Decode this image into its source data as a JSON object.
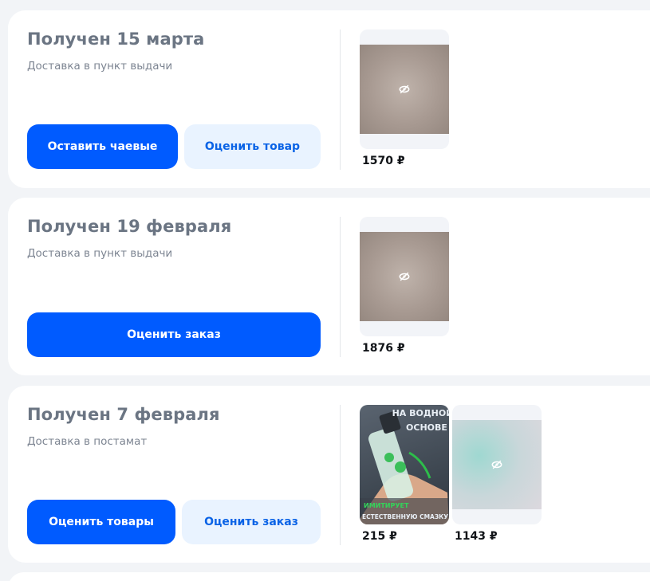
{
  "orders": [
    {
      "title": "Получен 15 марта",
      "subtitle": "Доставка в пункт выдачи",
      "buttons": [
        "Оставить чаевые",
        "Оценить товар"
      ],
      "products": [
        {
          "price": "1570 ₽",
          "image": "hidden-blurred"
        }
      ]
    },
    {
      "title": "Получен 19 февраля",
      "subtitle": "Доставка в пункт выдачи",
      "buttons": [
        "Оценить заказ"
      ],
      "products": [
        {
          "price": "1876 ₽",
          "image": "hidden-blurred"
        }
      ]
    },
    {
      "title": "Получен 7 февраля",
      "subtitle": "Доставка в постамат",
      "buttons": [
        "Оценить товары",
        "Оценить заказ"
      ],
      "products": [
        {
          "price": "215 ₽",
          "image": "product-photo",
          "image_text": [
            "НА ВОДНОЙ",
            "ОСНОВЕ",
            "ИМИТИРУЕТ",
            "ЕСТЕСТВЕННУЮ СМАЗКУ"
          ]
        },
        {
          "price": "1143 ₽",
          "image": "hidden-blurred"
        }
      ]
    }
  ],
  "colors": {
    "background": "#f2f4f7",
    "card": "#ffffff",
    "primary": "#005bff",
    "secondary_bg": "#e9f3ff",
    "secondary_text": "#0a63e6",
    "title": "#6b7583"
  }
}
